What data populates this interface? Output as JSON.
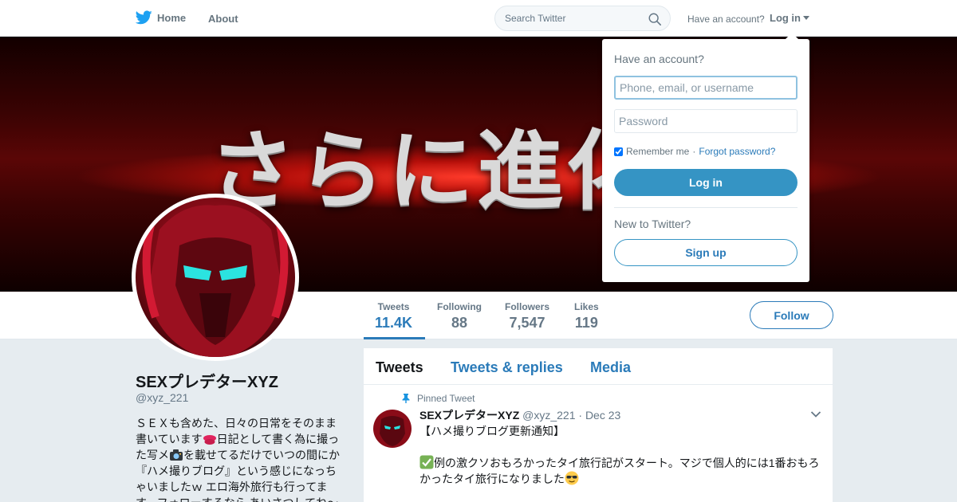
{
  "nav": {
    "home_label": "Home",
    "about_label": "About",
    "search_placeholder": "Search Twitter",
    "have_account": "Have an account?",
    "login_label": "Log in"
  },
  "banner": {
    "text": "さらに進化"
  },
  "stats": [
    {
      "label": "Tweets",
      "value": "11.4K",
      "active": true
    },
    {
      "label": "Following",
      "value": "88"
    },
    {
      "label": "Followers",
      "value": "7,547"
    },
    {
      "label": "Likes",
      "value": "119"
    }
  ],
  "follow_label": "Follow",
  "profile": {
    "name": "SEXプレデターXYZ",
    "handle": "@xyz_221",
    "bio_parts": [
      "ＳＥＸも含めた、日々の日常をそのまま書いています",
      "日記として書く為に撮った写メ",
      "を載せてるだけでいつの間にか『ハメ撮りブログ』という感じになっちゃいましたｗ エロ海外旅行も行ってます。フォローするなら あいさつしてね〜"
    ]
  },
  "timeline": {
    "tabs": [
      "Tweets",
      "Tweets & replies",
      "Media"
    ],
    "pinned_label": "Pinned Tweet",
    "tweet": {
      "name": "SEXプレデターXYZ",
      "handle": "@xyz_221",
      "date": "· Dec 23",
      "line1": "【ハメ撮りブログ更新通知】",
      "line2": "例の激クソおもろかったタイ旅行記がスタート。マジで個人的には1番おもろかったタイ旅行になりました"
    }
  },
  "login_dropdown": {
    "title": "Have an account?",
    "username_placeholder": "Phone, email, or username",
    "password_placeholder": "Password",
    "remember_label": "Remember me",
    "separator": "·",
    "forgot_label": "Forgot password?",
    "login_button": "Log in",
    "new_label": "New to Twitter?",
    "signup_button": "Sign up"
  },
  "colors": {
    "accent": "#2b7bb9",
    "login_button": "#3594c4",
    "twitter_blue": "#1da1f2",
    "background": "#e6ecf0"
  }
}
